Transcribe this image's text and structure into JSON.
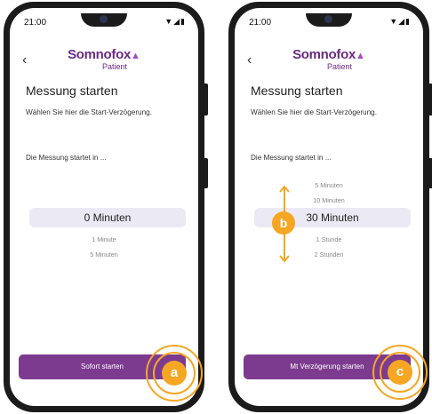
{
  "status": {
    "time": "21:00",
    "icons": "▼◢▮"
  },
  "logo": {
    "name": "Somnofox",
    "sub": "Patient"
  },
  "back_icon": "chevron-left-icon",
  "left_screen": {
    "title": "Messung starten",
    "description": "Wählen Sie hier die Start-Verzögerung.",
    "prompt": "Die Messung startet in ...",
    "selected": "0 Minuten",
    "below": [
      "1 Minute",
      "5 Minuten"
    ],
    "button": "Sofort starten",
    "badge": "a"
  },
  "right_screen": {
    "title": "Messung starten",
    "description": "Wählen Sie hier die Start-Verzögerung.",
    "prompt": "Die Messung startet in ...",
    "above": [
      "5 Minuten",
      "10 Minuten"
    ],
    "selected": "30 Minuten",
    "below": [
      "1 Stunde",
      "2 Stunden"
    ],
    "button": "Mt Verzögerung starten",
    "badge_scroll": "b",
    "badge": "c"
  },
  "colors": {
    "brand": "#7c3b8f",
    "accent": "#f5a623",
    "picker_bg": "#ebe9f3"
  }
}
